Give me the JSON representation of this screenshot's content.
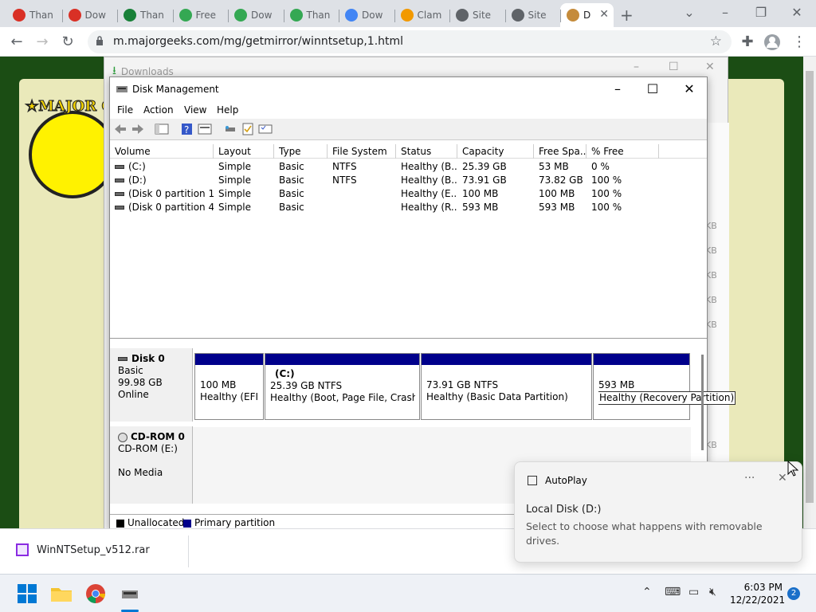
{
  "browser": {
    "tabs": [
      {
        "label": "Than",
        "color": "#d93025"
      },
      {
        "label": "Dow",
        "color": "#d93025"
      },
      {
        "label": "Than",
        "color": "#188038"
      },
      {
        "label": "Free",
        "color": "#34a853"
      },
      {
        "label": "Dow",
        "color": "#34a853"
      },
      {
        "label": "Than",
        "color": "#34a853"
      },
      {
        "label": "Dow",
        "color": "#4285f4"
      },
      {
        "label": "Clam",
        "color": "#f29900"
      },
      {
        "label": "Site",
        "color": "#5f6368"
      },
      {
        "label": "Site",
        "color": "#5f6368"
      },
      {
        "label": "D",
        "color": "#c58b3b"
      }
    ],
    "url": "m.majorgeeks.com/mg/getmirror/winntsetup,1.html"
  },
  "logo_text": "★MAJOR G",
  "downloads_window": {
    "title": "Downloads",
    "kb_labels": [
      "KB",
      "KB",
      "KB",
      "KB",
      "KB",
      "KB"
    ]
  },
  "disk_management": {
    "title": "Disk Management",
    "menu": [
      "File",
      "Action",
      "View",
      "Help"
    ],
    "columns": [
      "Volume",
      "Layout",
      "Type",
      "File System",
      "Status",
      "Capacity",
      "Free Spa...",
      "% Free"
    ],
    "volumes": [
      [
        "(C:)",
        "Simple",
        "Basic",
        "NTFS",
        "Healthy (B...",
        "25.39 GB",
        "53 MB",
        "0 %"
      ],
      [
        "(D:)",
        "Simple",
        "Basic",
        "NTFS",
        "Healthy (B...",
        "73.91 GB",
        "73.82 GB",
        "100 %"
      ],
      [
        "(Disk 0 partition 1)",
        "Simple",
        "Basic",
        "",
        "Healthy (E...",
        "100 MB",
        "100 MB",
        "100 %"
      ],
      [
        "(Disk 0 partition 4)",
        "Simple",
        "Basic",
        "",
        "Healthy (R...",
        "593 MB",
        "593 MB",
        "100 %"
      ]
    ],
    "disk0": {
      "name": "Disk 0",
      "type": "Basic",
      "size": "99.98 GB",
      "state": "Online",
      "partitions": [
        {
          "name": "",
          "size": "100 MB",
          "status": "Healthy (EFI S"
        },
        {
          "name": "(C:)",
          "size": "25.39 GB NTFS",
          "status": "Healthy (Boot, Page File, Crash Du"
        },
        {
          "name": "",
          "size": "73.91 GB NTFS",
          "status": "Healthy (Basic Data Partition)"
        },
        {
          "name": "",
          "size": "593 MB",
          "status": "Healthy (Recovery Partition)"
        }
      ]
    },
    "cdrom": {
      "name": "CD-ROM 0",
      "drive": "CD-ROM (E:)",
      "media": "No Media"
    },
    "legend": [
      {
        "label": "Unallocated",
        "color": "#000000"
      },
      {
        "label": "Primary partition",
        "color": "#00008b"
      }
    ]
  },
  "download_bar": {
    "file": "WinNTSetup_v512.rar"
  },
  "toast": {
    "app": "AutoPlay",
    "more": "···",
    "heading": "Local Disk (D:)",
    "body": "Select to choose what happens with removable drives."
  },
  "taskbar": {
    "time": "6:03 PM",
    "date": "12/22/2021",
    "notifications": "2"
  }
}
